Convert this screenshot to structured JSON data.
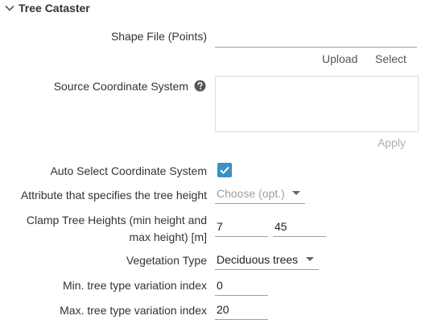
{
  "section": {
    "title": "Tree Cataster",
    "icon": "chevron-down-icon"
  },
  "shape_file": {
    "label": "Shape File (Points)",
    "value": "",
    "upload_label": "Upload",
    "select_label": "Select"
  },
  "source_crs": {
    "label": "Source Coordinate System",
    "help_icon": "help-icon",
    "value": "",
    "apply_label": "Apply"
  },
  "auto_select": {
    "label": "Auto Select Coordinate System",
    "checked": true
  },
  "height_attribute": {
    "label": "Attribute that specifies the tree height",
    "placeholder": "Choose (opt.)"
  },
  "clamp": {
    "label_line1": "Clamp Tree Heights (min height and",
    "label_line2": "max height) [m]",
    "min_value": "7",
    "max_value": "45"
  },
  "vegetation": {
    "label": "Vegetation Type",
    "value": "Deciduous trees"
  },
  "min_variation": {
    "label": "Min. tree type variation index",
    "value": "0"
  },
  "max_variation": {
    "label": "Max. tree type variation index",
    "value": "20"
  },
  "colors": {
    "accent": "#3a8fc7",
    "text": "#333333",
    "muted": "#9e9e9e"
  }
}
